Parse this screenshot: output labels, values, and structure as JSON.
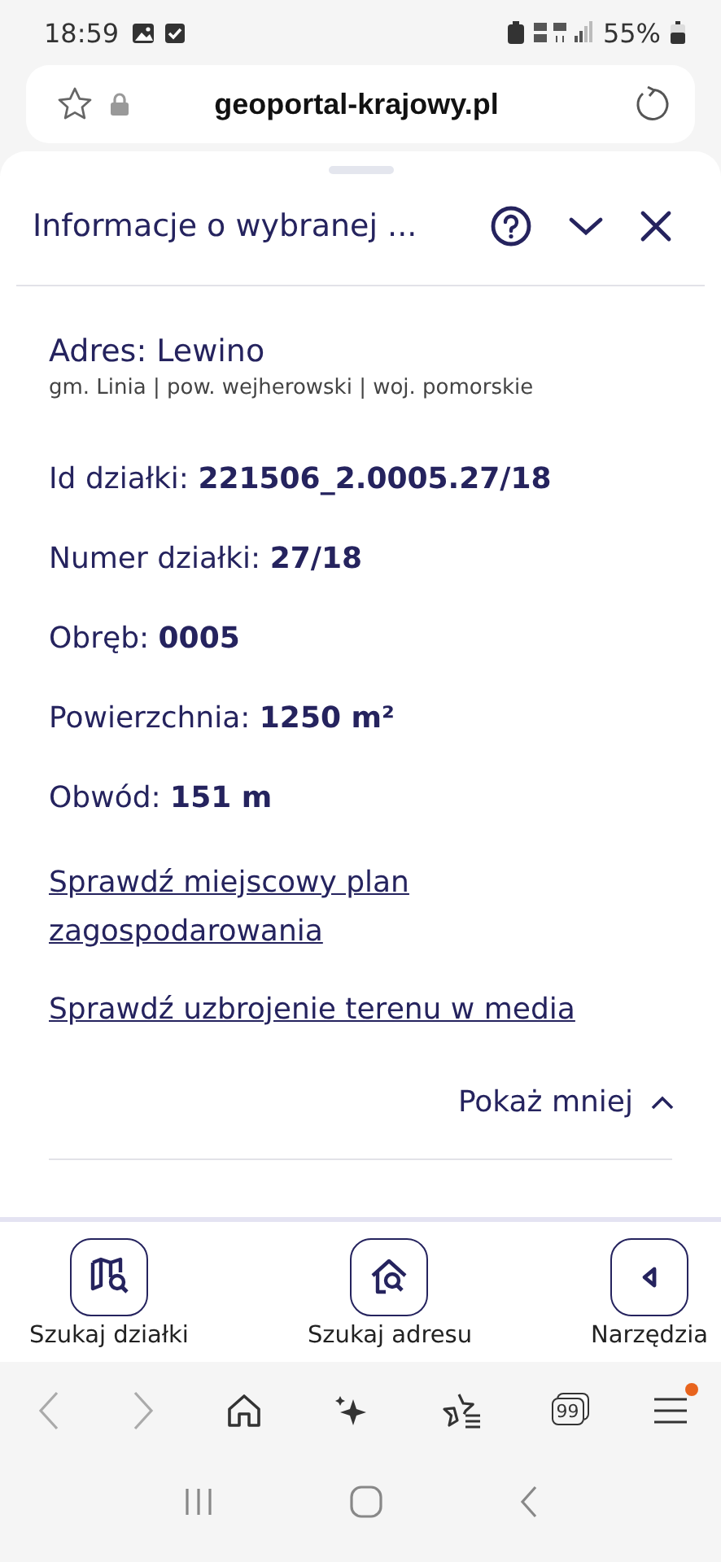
{
  "status_bar": {
    "time": "18:59",
    "battery": "55%"
  },
  "address_bar": {
    "url": "geoportal-krajowy.pl"
  },
  "panel": {
    "title": "Informacje o wybranej ...",
    "address": {
      "label": "Adres:",
      "value": "Lewino",
      "detail": "gm. Linia | pow. wejherowski | woj. pomorskie"
    },
    "fields": [
      {
        "label": "Id działki:",
        "value": "221506_2.0005.27/18"
      },
      {
        "label": "Numer działki:",
        "value": "27/18"
      },
      {
        "label": "Obręb:",
        "value": "0005"
      },
      {
        "label": "Powierzchnia:",
        "value": "1250 m²"
      },
      {
        "label": "Obwód:",
        "value": "151 m"
      }
    ],
    "links": [
      "Sprawdź miejscowy plan zagospodarowania",
      "Sprawdź uzbrojenie terenu w media"
    ],
    "toggle": {
      "label": "Pokaż mniej",
      "expanded": true
    }
  },
  "toolbar": [
    {
      "kind": "parcel",
      "label": "Szukaj działki"
    },
    {
      "kind": "address",
      "label": "Szukaj adresu"
    },
    {
      "kind": "tools",
      "label": "Narzędzia"
    }
  ],
  "browser_nav": {
    "back_disabled": true,
    "forward_disabled": true,
    "tabs_count": "99",
    "menu_badge": true
  }
}
